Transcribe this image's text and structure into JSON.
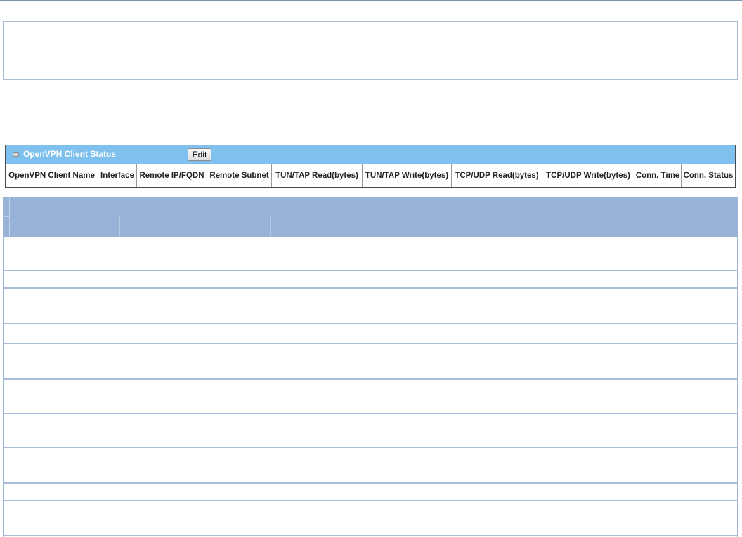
{
  "status_panel": {
    "title": "OpenVPN Client Status",
    "edit_label": "Edit",
    "columns": [
      "OpenVPN Client Name",
      "Interface",
      "Remote IP/FQDN",
      "Remote Subnet",
      "TUN/TAP Read(bytes)",
      "TUN/TAP Write(bytes)",
      "TCP/UDP Read(bytes)",
      "TCP/UDP Write(bytes)",
      "Conn. Time",
      "Conn. Status"
    ]
  },
  "colors": {
    "status_header_bg": "#7ec0ee",
    "grid_header_bg": "#98b3d7",
    "grid_line": "#a7bcd8"
  }
}
